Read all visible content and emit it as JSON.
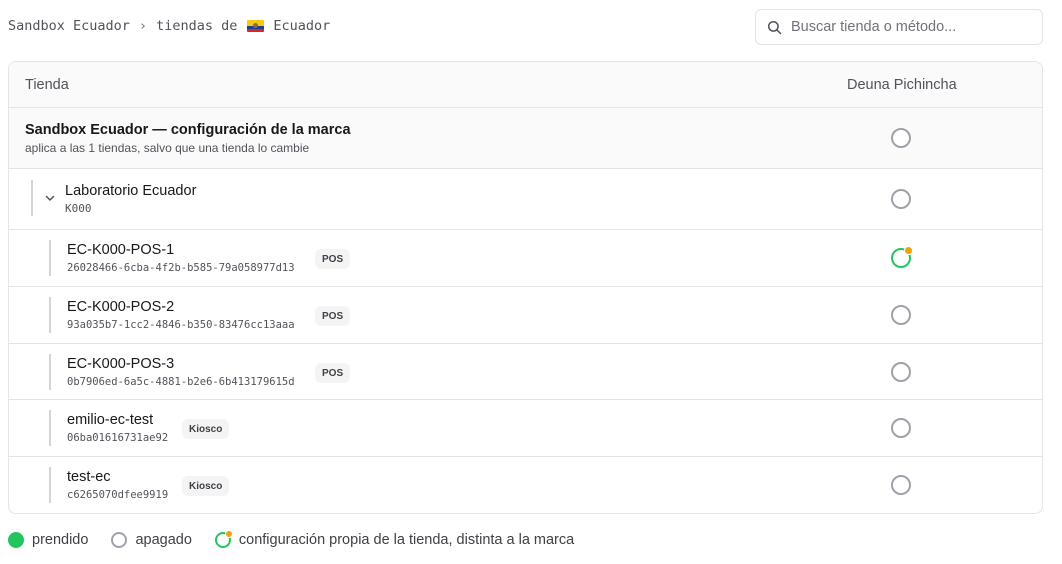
{
  "breadcrumb": {
    "root": "Sandbox Ecuador",
    "separator": "›",
    "current_prefix": "tiendas de",
    "country": "Ecuador"
  },
  "search": {
    "placeholder": "Buscar tienda o método..."
  },
  "table": {
    "columns": {
      "store": "Tienda",
      "method": "Deuna Pichincha"
    },
    "brand": {
      "title": "Sandbox Ecuador — configuración de la marca",
      "subtitle": "aplica a las 1 tiendas, salvo que una tienda lo cambie",
      "status": "apagado"
    },
    "group": {
      "name": "Laboratorio Ecuador",
      "code": "K000",
      "status": "apagado"
    },
    "stores": [
      {
        "name": "EC-K000-POS-1",
        "id": "26028466-6cba-4f2b-b585-79a058977d13",
        "type": "POS",
        "status": "configuración propia"
      },
      {
        "name": "EC-K000-POS-2",
        "id": "93a035b7-1cc2-4846-b350-83476cc13aaa",
        "type": "POS",
        "status": "apagado"
      },
      {
        "name": "EC-K000-POS-3",
        "id": "0b7906ed-6a5c-4881-b2e6-6b413179615d",
        "type": "POS",
        "status": "apagado"
      },
      {
        "name": "emilio-ec-test",
        "id": "06ba01616731ae92",
        "type": "Kiosco",
        "status": "apagado"
      },
      {
        "name": "test-ec",
        "id": "c6265070dfee9919",
        "type": "Kiosco",
        "status": "apagado"
      }
    ]
  },
  "legend": {
    "on": "prendido",
    "off": "apagado",
    "custom": "configuración propia de la tienda, distinta a la marca"
  },
  "colors": {
    "on": "#22c55e",
    "custom_marker": "#f59e0b",
    "off_border": "#a1a1aa"
  },
  "icons": {
    "search": "search-icon",
    "chevron": "chevron-down-icon",
    "flag": "ecuador-flag-icon"
  }
}
